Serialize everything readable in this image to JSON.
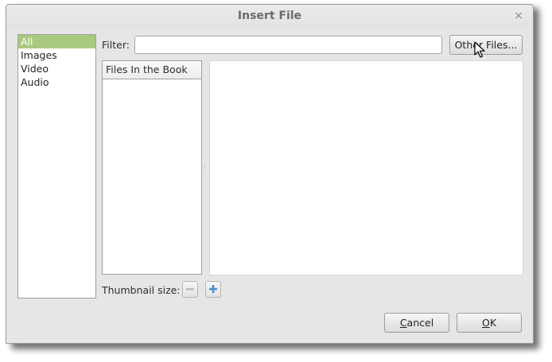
{
  "window": {
    "title": "Insert File",
    "close_glyph": "×"
  },
  "categories": [
    {
      "label": "All",
      "selected": true
    },
    {
      "label": "Images",
      "selected": false
    },
    {
      "label": "Video",
      "selected": false
    },
    {
      "label": "Audio",
      "selected": false
    }
  ],
  "filter": {
    "label": "Filter:",
    "value": "",
    "placeholder": ""
  },
  "other_files_button": {
    "label": "Other Files..."
  },
  "files_list": {
    "header": "Files In the Book",
    "items": []
  },
  "thumbnail": {
    "label": "Thumbnail size:",
    "decrease_icon": "minus-icon",
    "increase_icon": "plus-icon"
  },
  "footer": {
    "cancel_label": "Cancel",
    "cancel_mnemonic": "C",
    "ok_label": "OK",
    "ok_mnemonic": "O"
  },
  "colors": {
    "selection": "#a9c97f",
    "plus_icon": "#4a8fd0",
    "window_bg": "#e6e6e6"
  }
}
